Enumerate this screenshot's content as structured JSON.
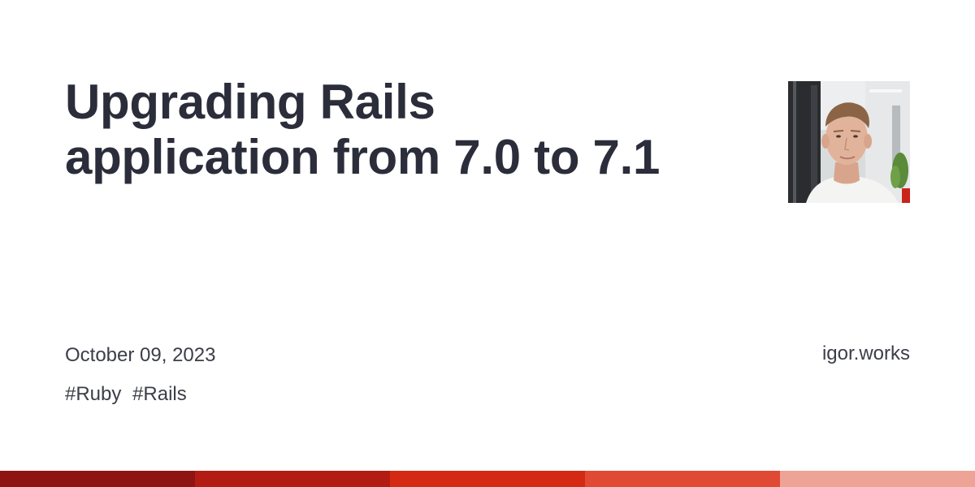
{
  "post": {
    "title_lines": [
      "Upgrading Rails",
      "application from 7.0 to 7.1"
    ],
    "date": "October 09, 2023",
    "tags": [
      "#Ruby",
      "#Rails"
    ],
    "site": "igor.works"
  },
  "author_photo": {
    "description": "author-portrait"
  },
  "colors": {
    "title": "#2b2d3a",
    "meta_text": "#3c3e48",
    "stripe": [
      "#8f1512",
      "#b21c13",
      "#d42a14",
      "#e04a34",
      "#eda496"
    ]
  }
}
